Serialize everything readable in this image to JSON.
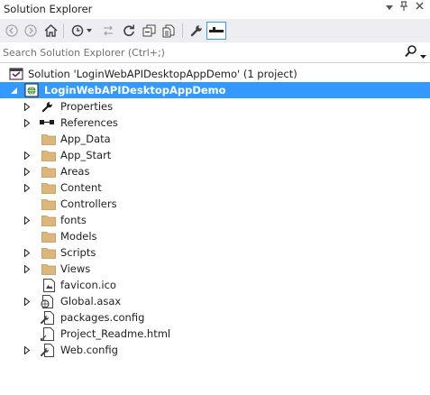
{
  "window": {
    "title": "Solution Explorer",
    "controls": [
      "pin-dropdown",
      "pin",
      "close"
    ]
  },
  "search": {
    "placeholder": "Search Solution Explorer (Ctrl+;)"
  },
  "toolbar": {
    "buttons": [
      "back",
      "forward",
      "home",
      "history",
      "sync",
      "refresh",
      "collapse-all",
      "show-all-files",
      "properties",
      "preview"
    ]
  },
  "tree": {
    "solution": "Solution 'LoginWebAPIDesktopAppDemo' (1 project)",
    "project": "LoginWebAPIDesktopAppDemo",
    "items": [
      {
        "label": "Properties",
        "icon": "wrench-icon",
        "expandable": true
      },
      {
        "label": "References",
        "icon": "references-icon",
        "expandable": true
      },
      {
        "label": "App_Data",
        "icon": "folder-icon",
        "expandable": false
      },
      {
        "label": "App_Start",
        "icon": "folder-icon",
        "expandable": true
      },
      {
        "label": "Areas",
        "icon": "folder-icon",
        "expandable": true
      },
      {
        "label": "Content",
        "icon": "folder-icon",
        "expandable": true
      },
      {
        "label": "Controllers",
        "icon": "folder-icon",
        "expandable": false
      },
      {
        "label": "fonts",
        "icon": "folder-icon",
        "expandable": true
      },
      {
        "label": "Models",
        "icon": "folder-icon",
        "expandable": false
      },
      {
        "label": "Scripts",
        "icon": "folder-icon",
        "expandable": true
      },
      {
        "label": "Views",
        "icon": "folder-icon",
        "expandable": true
      },
      {
        "label": "favicon.ico",
        "icon": "image-file-icon",
        "expandable": false
      },
      {
        "label": "Global.asax",
        "icon": "global-asax-icon",
        "expandable": true
      },
      {
        "label": "packages.config",
        "icon": "config-file-icon",
        "expandable": false
      },
      {
        "label": "Project_Readme.html",
        "icon": "html-file-icon",
        "expandable": false
      },
      {
        "label": "Web.config",
        "icon": "config-file-icon",
        "expandable": true
      }
    ]
  },
  "colors": {
    "selection": "#3399ff",
    "folder": "#dcb67a",
    "toolbar_bg": "#eeeef2"
  }
}
